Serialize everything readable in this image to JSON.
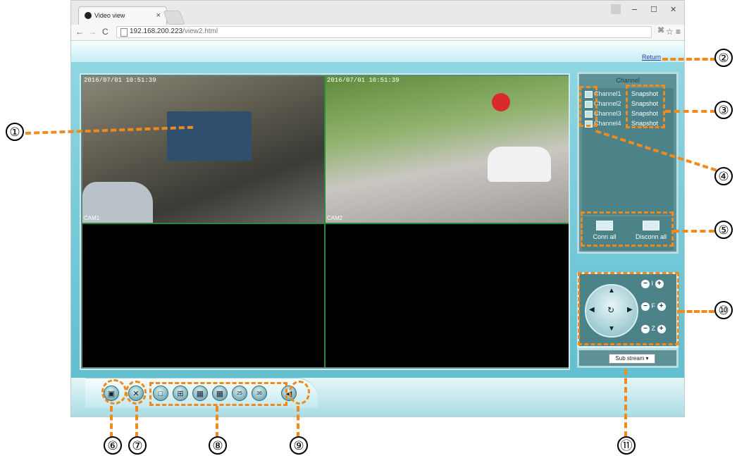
{
  "browser": {
    "tab_title": "Video view",
    "tab_close": "×",
    "url_host": "192.168.200.223",
    "url_path": "/view2.html",
    "win_min": "–",
    "win_max": "☐",
    "win_close": "✕"
  },
  "page": {
    "return_link": "Return",
    "video": {
      "cells": [
        {
          "timestamp": "2016/07/01 10:51:39",
          "cam": "CAM1"
        },
        {
          "timestamp": "2016/07/01 10:51:39",
          "cam": "CAM2"
        },
        {
          "timestamp": "",
          "cam": ""
        },
        {
          "timestamp": "",
          "cam": ""
        }
      ]
    },
    "channel_panel": {
      "title": "Channel",
      "channels": [
        "Channel1",
        "Channel2",
        "Channel3",
        "Channel4"
      ],
      "snapshot_label": "Snapshot",
      "conn_all": "Conn all",
      "disconn_all": "Disconn all"
    },
    "ptz": {
      "iris_label": "I",
      "focus_label": "F",
      "zoom_label": "Z"
    },
    "stream_select": "Sub stream"
  },
  "callouts": [
    "①",
    "②",
    "③",
    "④",
    "⑤",
    "⑥",
    "⑦",
    "⑧",
    "⑨",
    "⑩",
    "⑪"
  ]
}
